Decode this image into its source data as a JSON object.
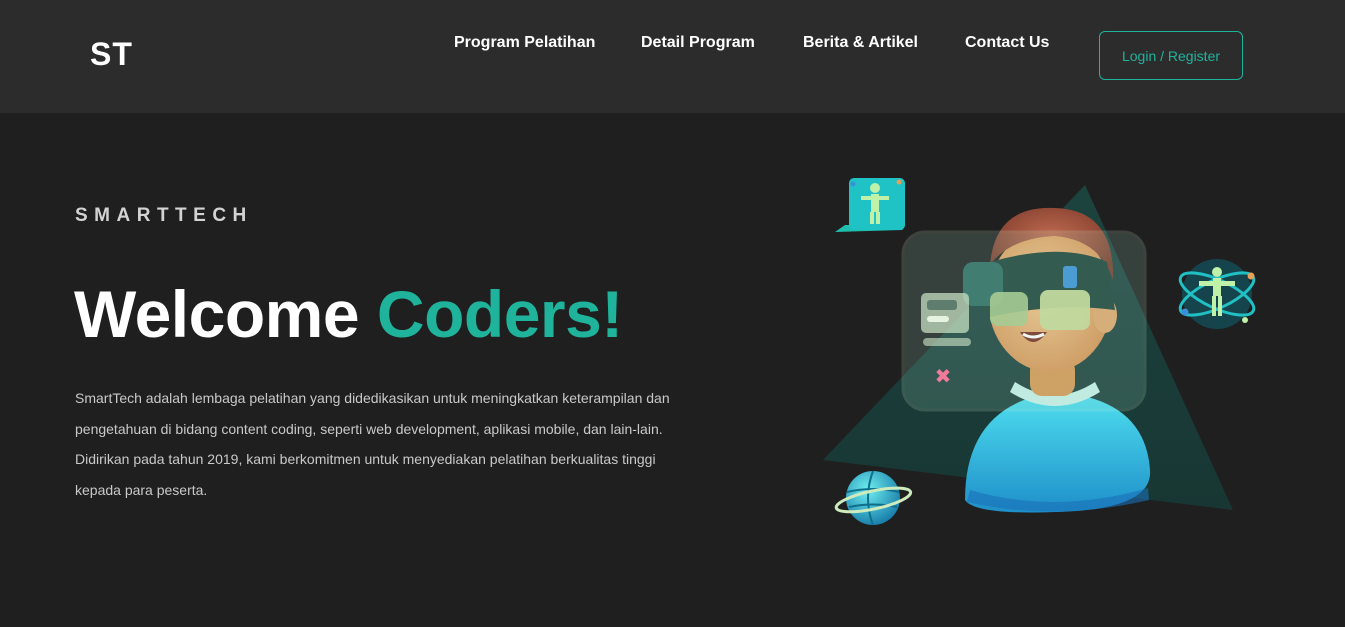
{
  "nav": {
    "logo": "ST",
    "links": [
      "Program Pelatihan",
      "Detail Program",
      "Berita & Artikel",
      "Contact Us"
    ],
    "login_label": "Login / Register"
  },
  "hero": {
    "eyebrow": "SMARTTECH",
    "headline_part1": "Welcome ",
    "headline_accent": "Coders!",
    "description": "SmartTech adalah lembaga pelatihan yang didedikasikan untuk meningkatkan keterampilan dan pengetahuan di bidang content coding, seperti web development, aplikasi mobile, dan lain-lain. Didirikan pada tahun 2019, kami berkomitmen untuk menyediakan pelatihan berkualitas tinggi kepada para peserta."
  },
  "colors": {
    "accent": "#1fb39c",
    "navbar_bg": "#2c2c2c",
    "page_bg": "#1f1f1f"
  },
  "illustration": {
    "icons": [
      "vr-headset-person-illustration",
      "hologram-screen-icon",
      "vitruvian-atom-icon",
      "planet-icon"
    ]
  }
}
